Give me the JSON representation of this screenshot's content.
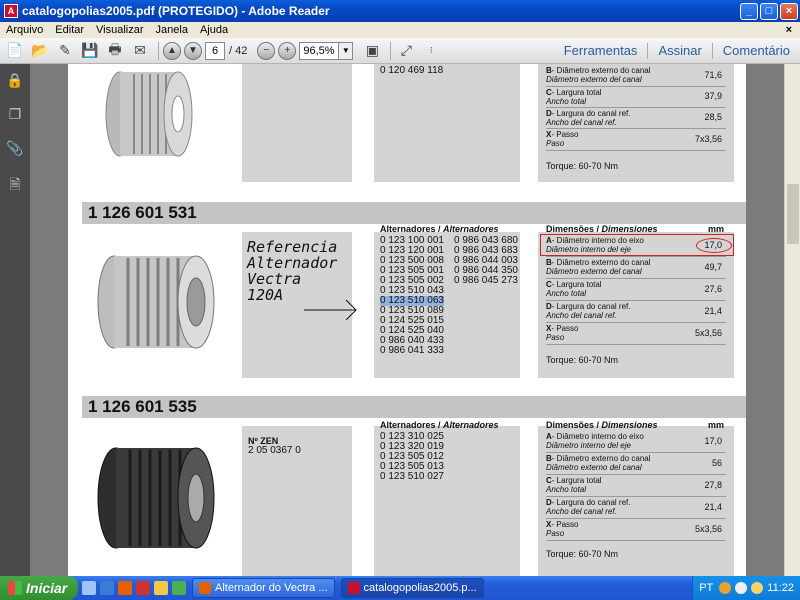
{
  "window": {
    "title": "catalogopolias2005.pdf (PROTEGIDO) - Adobe Reader",
    "controls": [
      "_",
      "□",
      "×"
    ]
  },
  "menu": [
    "Arquivo",
    "Editar",
    "Visualizar",
    "Janela",
    "Ajuda"
  ],
  "toolbar": {
    "page_current": "6",
    "page_total": "/ 42",
    "zoom": "96,5%",
    "links": [
      "Ferramentas",
      "Assinar",
      "Comentário"
    ]
  },
  "document": {
    "top_section": {
      "part_number_tail": "0 120 469 118",
      "dims": [
        {
          "code": "B",
          "label": "- Diâmetro externo do canal",
          "label_es": "Diâmetro externo del canal",
          "value": "71,6"
        },
        {
          "code": "C",
          "label": "- Largura total",
          "label_es": "Ancho total",
          "value": "37,9"
        },
        {
          "code": "D",
          "label": "- Largura do canal ref.",
          "label_es": "Ancho del canal ref.",
          "value": "28,5"
        },
        {
          "code": "X",
          "label": "- Passo",
          "label_es": "Paso",
          "value": "7x3,56"
        }
      ],
      "torque": "Torque: 60-70 Nm"
    },
    "section1": {
      "part_number": "1 126 601 531",
      "alternators_header": "Alternadores / ",
      "alternators_header_es": "Alternadores",
      "alternators_col1": [
        "0 123 100 001",
        "0 123 120 001",
        "0 123 500 008",
        "0 123 505 001",
        "0 123 505 002",
        "0 123 510 043",
        "0 123 510 063",
        "0 123 510 089",
        "0 124 525 015",
        "0 124 525 040",
        "0 986 040 433",
        "0 986 041 333"
      ],
      "alternators_col2": [
        "0 986 043 680",
        "0 986 043 683",
        "0 986 044 003",
        "0 986 044 350",
        "0 986 045 273"
      ],
      "highlighted": "0 123 510 063",
      "dim_header": "Dimensões / ",
      "dim_header_es": "Dimensiones",
      "dim_unit": "mm",
      "dims": [
        {
          "code": "A",
          "label": "- Diâmetro interno do eixo",
          "label_es": "Diâmetro interno del eje",
          "value": "17,0"
        },
        {
          "code": "B",
          "label": "- Diâmetro externo do canal",
          "label_es": "Diâmetro externo del canal",
          "value": "49,7"
        },
        {
          "code": "C",
          "label": "- Largura total",
          "label_es": "Ancho total",
          "value": "27,6"
        },
        {
          "code": "D",
          "label": "- Largura do canal ref.",
          "label_es": "Ancho del canal ref.",
          "value": "21,4"
        },
        {
          "code": "X",
          "label": "- Passo",
          "label_es": "Paso",
          "value": "5x3,56"
        }
      ],
      "torque": "Torque: 60-70 Nm",
      "note_lines": [
        "Referencia",
        "Alternador",
        "Vectra",
        "120A"
      ]
    },
    "section2": {
      "part_number": "1 126 601 535",
      "zen_label": "Nº ZEN",
      "zen_value": "2 05 0367 0",
      "alternators_header": "Alternadores / ",
      "alternators_header_es": "Alternadores",
      "alternators_col1": [
        "0 123 310 025",
        "0 123 320 019",
        "0 123 505 012",
        "0 123 505 013",
        "0 123 510 027"
      ],
      "dim_header": "Dimensões / ",
      "dim_header_es": "Dimensiones",
      "dim_unit": "mm",
      "dims": [
        {
          "code": "A",
          "label": "- Diâmetro interno do eixo",
          "label_es": "Diâmetro interno del eje",
          "value": "17,0"
        },
        {
          "code": "B",
          "label": "- Diâmetro externo do canal",
          "label_es": "Diâmetro externo del canal",
          "value": "56"
        },
        {
          "code": "C",
          "label": "- Largura total",
          "label_es": "Ancho total",
          "value": "27,8"
        },
        {
          "code": "D",
          "label": "- Largura do canal ref.",
          "label_es": "Ancho del canal ref.",
          "value": "21,4"
        },
        {
          "code": "X",
          "label": "- Passo",
          "label_es": "Paso",
          "value": "5x3,56"
        }
      ],
      "torque": "Torque: 60-70 Nm"
    }
  },
  "taskbar": {
    "start": "Iniciar",
    "tasks": [
      "Alternador do Vectra ...",
      "catalogopolias2005.p..."
    ],
    "lang": "PT",
    "clock": "11:22"
  }
}
